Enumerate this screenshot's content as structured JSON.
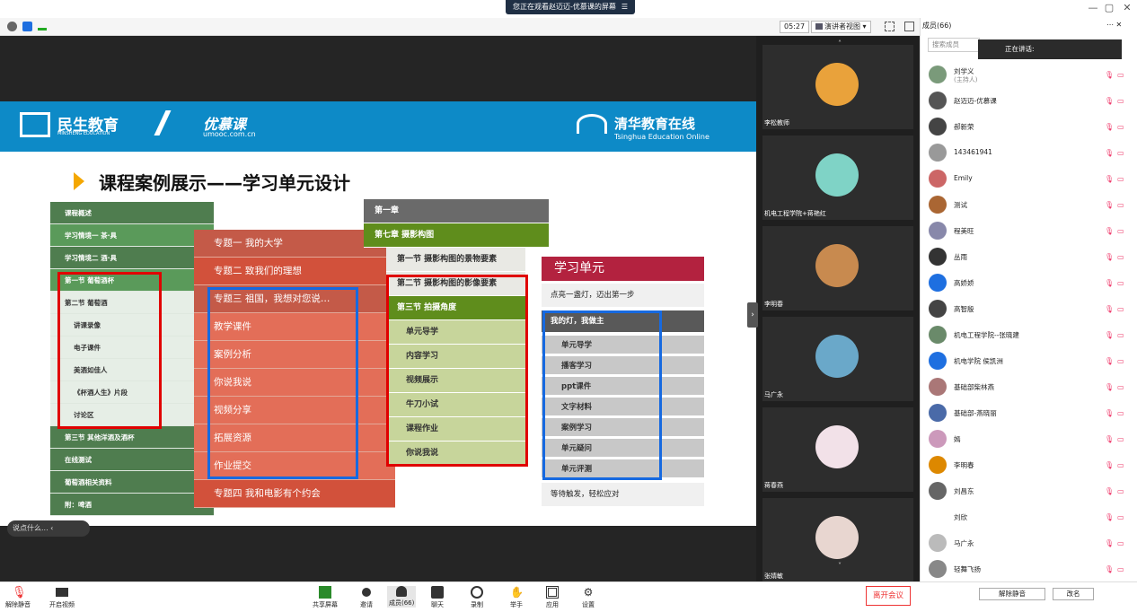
{
  "window": {
    "share_banner": "您正在观看赵迈迈-优慕课的屏幕",
    "banner_icon": "☰",
    "min": "—",
    "max": "▢",
    "close": "✕"
  },
  "toolbar": {
    "time": "05:27",
    "view_mode": "演讲者视图",
    "view_caret": "▾"
  },
  "slide": {
    "logo1_cn": "民生教育",
    "logo1_en": "MINSHENG EDUCATION",
    "logo2_cn": "优慕课",
    "logo2_en": "umooc.com.cn",
    "logo3_cn": "清华教育在线",
    "logo3_en": "Tsinghua Education Online",
    "title": "课程案例展示——学习单元设计",
    "col1": [
      "课程概述",
      "学习情境一 茶·具",
      "学习情境二 酒·具",
      "第一节 葡萄酒杯",
      "第二节 葡萄酒",
      "讲课录像",
      "电子课件",
      "美酒如佳人",
      "《杯酒人生》片段",
      "讨论区",
      "第三节 其他洋酒及酒杯",
      "在线测试",
      "葡萄酒相关资料",
      "附：啤酒"
    ],
    "col2": [
      "专题一 我的大学",
      "专题二 致我们的理想",
      "专题三 祖国，我想对您说…",
      "教学课件",
      "案例分析",
      "你说我说",
      "视频分享",
      "拓展资源",
      "作业提交",
      "专题四 我和电影有个约会"
    ],
    "col3": [
      "第一章",
      "第七章 摄影构图",
      "第一节 摄影构图的景物要素",
      "第二节 摄影构图的影像要素",
      "第三节 拍摄角度",
      "单元导学",
      "内容学习",
      "视频展示",
      "牛刀小试",
      "课程作业",
      "你说我说"
    ],
    "col4_header": "学习单元",
    "col4_sub": "点亮一盏灯，迈出第一步",
    "col4_dark": "我的灯，我做主",
    "col4": [
      "单元导学",
      "播客学习",
      "ppt课件",
      "文字材料",
      "案例学习",
      "单元疑问",
      "单元评测"
    ],
    "col4_footer": "等待触发，轻松应对"
  },
  "tiles": [
    "李松教师",
    "机电工程学院+蒋艳红",
    "李明春",
    "马广永",
    "蒋春燕",
    "张婧敏"
  ],
  "chat_placeholder": "说点什么...",
  "bottom": {
    "mute": "解除静音",
    "video": "开启视频",
    "share": "共享屏幕",
    "invite": "邀请",
    "members": "成员(66)",
    "chat": "聊天",
    "record": "录制",
    "raise": "举手",
    "apps": "应用",
    "settings": "设置",
    "leave": "离开会议"
  },
  "members_panel": {
    "title": "成员(66)",
    "search_placeholder": "搜索成员",
    "speaking": "正在讲话:",
    "members": [
      {
        "name": "刘学义",
        "role": "(主持人)"
      },
      {
        "name": "赵迈迈-优慕课",
        "role": ""
      },
      {
        "name": "郝新荣",
        "role": ""
      },
      {
        "name": "143461941",
        "role": ""
      },
      {
        "name": "Emily",
        "role": ""
      },
      {
        "name": "测试",
        "role": ""
      },
      {
        "name": "程美旺",
        "role": ""
      },
      {
        "name": "丛雨",
        "role": ""
      },
      {
        "name": "高娇娇",
        "role": ""
      },
      {
        "name": "高智殷",
        "role": ""
      },
      {
        "name": "机电工程学院--张晓建",
        "role": ""
      },
      {
        "name": "机电学院 侯凯洲",
        "role": ""
      },
      {
        "name": "基础部柴林燕",
        "role": ""
      },
      {
        "name": "基础部-燕晓丽",
        "role": ""
      },
      {
        "name": "嫣",
        "role": ""
      },
      {
        "name": "李明春",
        "role": ""
      },
      {
        "name": "刘昌东",
        "role": ""
      },
      {
        "name": "刘欣",
        "role": ""
      },
      {
        "name": "马广永",
        "role": ""
      },
      {
        "name": "轻舞飞扬",
        "role": ""
      }
    ],
    "unmute_all": "解除静音",
    "rename": "改名"
  }
}
